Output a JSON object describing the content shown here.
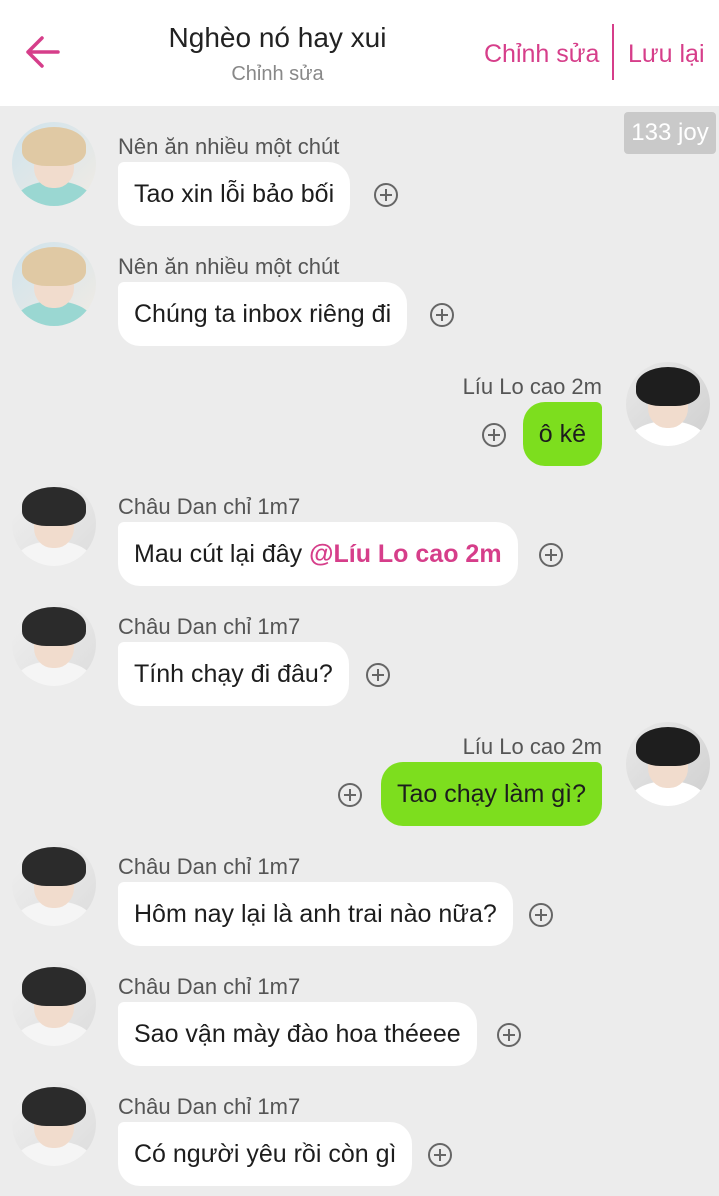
{
  "header": {
    "title": "Nghèo nó hay xui",
    "subtitle": "Chỉnh sửa",
    "edit_label": "Chỉnh sửa",
    "save_label": "Lưu lại"
  },
  "badge": {
    "joy": "133 joy"
  },
  "colors": {
    "accent": "#d63e8a",
    "sent_bubble": "#7dde1e",
    "received_bubble": "#ffffff"
  },
  "messages": [
    {
      "side": "left",
      "name": "Nên ăn nhiều một chút",
      "text": "Tao xin lỗi bảo bối"
    },
    {
      "side": "left",
      "name": "Nên ăn nhiều một chút",
      "text": "Chúng ta inbox riêng đi"
    },
    {
      "side": "right",
      "name": "Líu Lo cao 2m",
      "text": "ô kê"
    },
    {
      "side": "left",
      "name": "Châu Dan chỉ 1m7",
      "text": "Mau cút lại đây ",
      "mention": "@Líu Lo cao 2m"
    },
    {
      "side": "left",
      "name": "Châu Dan chỉ 1m7",
      "text": "Tính chạy đi đâu?"
    },
    {
      "side": "right",
      "name": "Líu Lo cao 2m",
      "text": "Tao chạy làm gì?"
    },
    {
      "side": "left",
      "name": "Châu Dan chỉ 1m7",
      "text": "Hôm nay lại là anh trai nào nữa?"
    },
    {
      "side": "left",
      "name": "Châu Dan chỉ 1m7",
      "text": "Sao vận mày đào hoa théeee"
    },
    {
      "side": "left",
      "name": "Châu Dan chỉ 1m7",
      "text": "Có người yêu rồi còn gì"
    }
  ]
}
